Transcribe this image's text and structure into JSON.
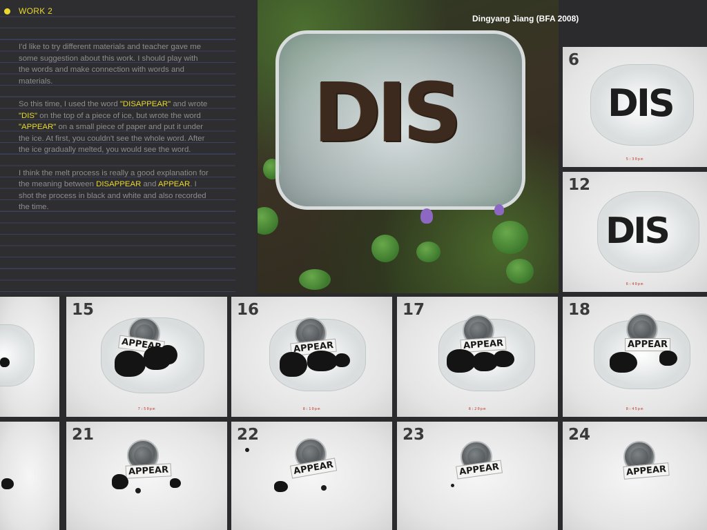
{
  "panel": {
    "title": "WORK 2",
    "accent_color": "#e9d82f",
    "para1": "I'd like to try different materials and teacher gave me some suggestion about this work. I should play with the words and make connection with words and materials.",
    "para2": {
      "t1": "So this time, I used the word ",
      "w1": "\"DISAPPEAR\"",
      "t2": " and wrote ",
      "w2": "\"DIS\"",
      "t3": " on the top of a  piece of ice, but wrote the word ",
      "w3": "\"APPEAR\"",
      "t4": "  on a  small piece of paper and put it under the ice. At first,  you couldn't see the whole word. After the ice gradually melted, you would see the word."
    },
    "para3": {
      "t1": "I think the melt process is really a good explanation for the meaning between ",
      "w1": "DISAPPEAR",
      "t2": " and ",
      "w2": "APPEAR",
      "t3": ". I shot the process in black and white and also recorded the time."
    }
  },
  "author": "Dingyang Jiang (BFA 2008)",
  "hero": {
    "word": "DIS"
  },
  "frames": [
    {
      "number": "6",
      "word": "DIS",
      "time": "5:30pm"
    },
    {
      "number": "12",
      "word": "DIS",
      "time": "6:40pm"
    },
    {
      "number": "",
      "word": "",
      "time": ""
    },
    {
      "number": "15",
      "word": "APPEAR",
      "time": "7:50pm"
    },
    {
      "number": "16",
      "word": "APPEAR",
      "time": "8:10pm"
    },
    {
      "number": "17",
      "word": "APPEAR",
      "time": "8:20pm"
    },
    {
      "number": "18",
      "word": "APPEAR",
      "time": "8:45pm"
    },
    {
      "number": "",
      "word": "",
      "time": ""
    },
    {
      "number": "21",
      "word": "APPEAR",
      "time": ""
    },
    {
      "number": "22",
      "word": "APPEAR",
      "time": ""
    },
    {
      "number": "23",
      "word": "APPEAR",
      "time": ""
    },
    {
      "number": "24",
      "word": "APPEAR",
      "time": ""
    }
  ]
}
